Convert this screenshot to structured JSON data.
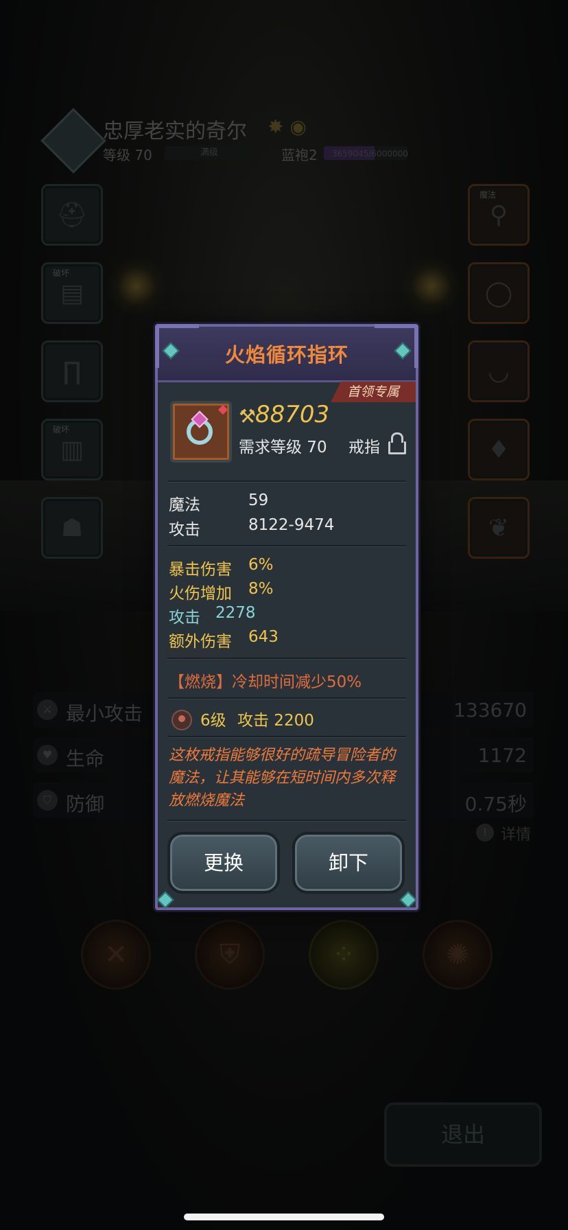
{
  "background": {
    "character": {
      "name": "忠厚老实的奇尔",
      "level_text": "等级 70",
      "level_bar_label": "满级",
      "robe_text": "蓝袍2",
      "exp_text": "3659045/6000000",
      "exp_fraction": 0.61
    },
    "left_slots": [
      {
        "tag": ""
      },
      {
        "tag": "破坏"
      },
      {
        "tag": ""
      },
      {
        "tag": "破坏"
      },
      {
        "tag": ""
      }
    ],
    "right_slots": [
      {
        "tag": "魔法"
      },
      {
        "tag": ""
      },
      {
        "tag": ""
      },
      {
        "tag": ""
      },
      {
        "tag": ""
      }
    ],
    "stats": [
      {
        "label": "最小攻击",
        "value": "133670"
      },
      {
        "label": "生命",
        "value": "1172"
      },
      {
        "label": "防御",
        "value": "0.75秒"
      }
    ],
    "detail_label": "详情",
    "exit_label": "退出"
  },
  "dialog": {
    "title": "火焰循环指环",
    "badge": "首领专属",
    "power": "88703",
    "required_level": "需求等级 70",
    "slot_type": "戒指",
    "base_attrs": [
      {
        "label": "魔法",
        "value": "59"
      },
      {
        "label": "攻击",
        "value": "8122-9474"
      }
    ],
    "bonus_attrs": [
      {
        "label": "暴击伤害",
        "value": "6%",
        "color": "#f1c54c"
      },
      {
        "label": "火伤增加",
        "value": "8%",
        "color": "#f1c54c"
      },
      {
        "label": "攻击",
        "value": "2278",
        "color": "#8ad4d8"
      },
      {
        "label": "额外伤害",
        "value": "643",
        "color": "#f1c54c"
      }
    ],
    "special_effect": "【燃烧】冷却时间减少50%",
    "enhance": {
      "level": "6级",
      "bonus": "攻击 2200"
    },
    "description": "这枚戒指能够很好的疏导冒险者的魔法，让其能够在短时间内多次释放燃烧魔法",
    "buttons": {
      "replace": "更换",
      "unequip": "卸下"
    }
  },
  "icons": {
    "power": "sword-power-icon",
    "lock": "lock-icon",
    "enhance": "enhance-level-icon",
    "item": "ring-icon"
  }
}
